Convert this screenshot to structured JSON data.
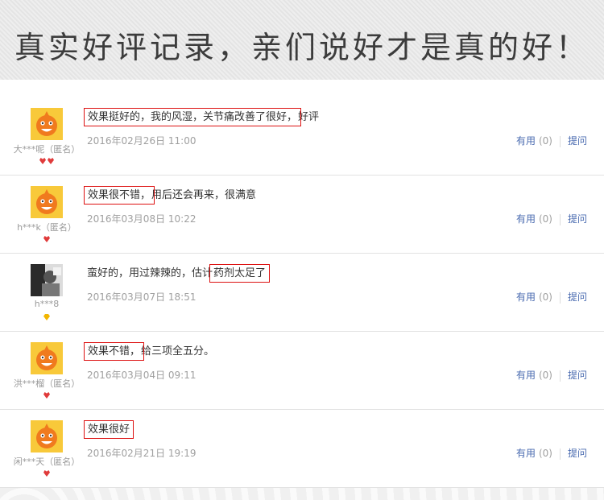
{
  "header": {
    "title": "真实好评记录，亲们说好才是真的好！"
  },
  "labels": {
    "helpful": "有用",
    "ask": "提问"
  },
  "reviews": [
    {
      "user": "大***呢（匿名）",
      "hl": "效果挺好的，我的风湿，关节痛改善了很好，",
      "rest": "好评",
      "pre": "",
      "date": "2016年02月26日 11:00",
      "count": "(0)",
      "badge": "red2"
    },
    {
      "user": "h***k（匿名）",
      "hl": "效果很不错，",
      "rest": "用后还会再来，很满意",
      "pre": "",
      "date": "2016年03月08日 10:22",
      "count": "(0)",
      "badge": "red1"
    },
    {
      "user": "h***8",
      "pre": "蛮好的，用过辣辣的，估计",
      "hl": "药剂太足了",
      "rest": "",
      "date": "2016年03月07日 18:51",
      "count": "(0)",
      "badge": "yellow"
    },
    {
      "user": "洪***榴（匿名）",
      "hl": "效果不错，",
      "rest": "给三项全五分。",
      "pre": "",
      "date": "2016年03月04日 09:11",
      "count": "(0)",
      "badge": "red1"
    },
    {
      "user": "闲***天（匿名）",
      "hl": "效果很好",
      "rest": "",
      "pre": "",
      "date": "2016年02月21日 19:19",
      "count": "(0)",
      "badge": "red1"
    }
  ]
}
